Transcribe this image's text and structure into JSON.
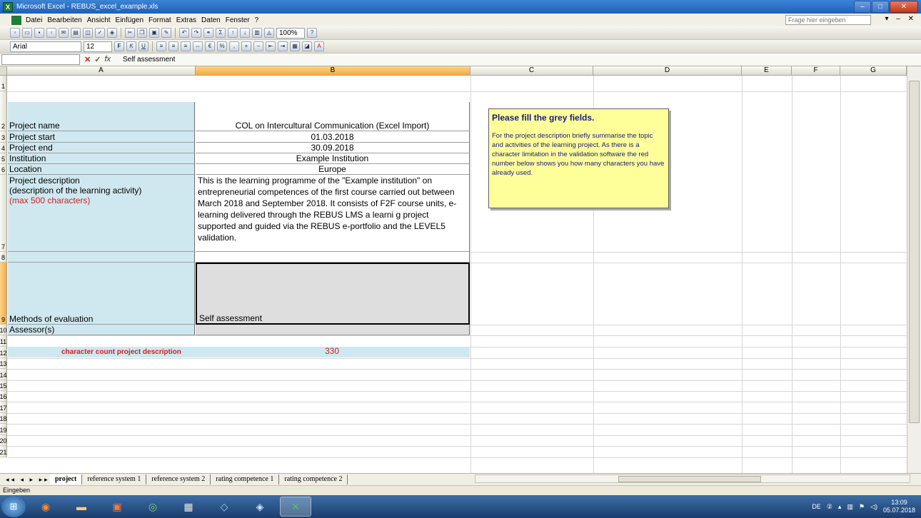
{
  "window": {
    "title": "Microsoft Excel - REBUS_excel_example.xls"
  },
  "menu": [
    "Datei",
    "Bearbeiten",
    "Ansicht",
    "Einfügen",
    "Format",
    "Extras",
    "Daten",
    "Fenster",
    "?"
  ],
  "ask_placeholder": "Frage hier eingeben",
  "toolbar": {
    "zoom": "100%",
    "font": "Arial",
    "font_size": "12"
  },
  "formula_bar": {
    "content": "Self assessment"
  },
  "columns": [
    "A",
    "B",
    "C",
    "D",
    "E",
    "F",
    "G"
  ],
  "selected_column": "B",
  "rows": [
    "1",
    "2",
    "3",
    "4",
    "5",
    "6",
    "7",
    "8",
    "9",
    "10",
    "11",
    "12",
    "13",
    "14",
    "15",
    "16",
    "17",
    "18",
    "19",
    "20",
    "21"
  ],
  "cells": {
    "a2": "Project name",
    "b2": "COL on Intercultural Communication (Excel Import)",
    "a3": "Project start",
    "b3": "01.03.2018",
    "a4": "Project end",
    "b4": "30.09.2018",
    "a5": "Institution",
    "b5": "Example Institution",
    "a6": "Location",
    "b6": "Europe",
    "a7_line1": "Project description",
    "a7_line2": "(description of the learning activity)",
    "a7_line3": "(max 500 characters)",
    "b7": "This is the learning programme of the \"Example institution\" on entrepreneurial competences of the first course carried out between March 2018 and September 2018. It consists of F2F course units, e-learning delivered through the REBUS LMS a learni g project supported and guided via the REBUS e-portfolio and the LEVEL5 validation.",
    "a9": "Methods of evaluation",
    "b9": "Self assessment",
    "a10": "Assessor(s)",
    "b10": "",
    "a12": "character count project description",
    "b12": "330"
  },
  "note": {
    "title": "Please fill the grey fields.",
    "body": "For the project description briefly summarise the topic and activities of the learning project. As there is a character limitation in the validation software the red number below shows you how many characters you have already used."
  },
  "sheet_tabs": [
    "project",
    "reference system 1",
    "reference system 2",
    "rating competence 1",
    "rating competence 2"
  ],
  "active_sheet": "project",
  "status": "Eingeben",
  "tray": {
    "lang": "DE",
    "time": "13:09",
    "date": "05.07.2018"
  },
  "colors": {
    "accent_blue": "#cfe8f0",
    "grey_field": "#dedede",
    "note_yellow": "#ffff99",
    "red_text": "#cc2222"
  }
}
